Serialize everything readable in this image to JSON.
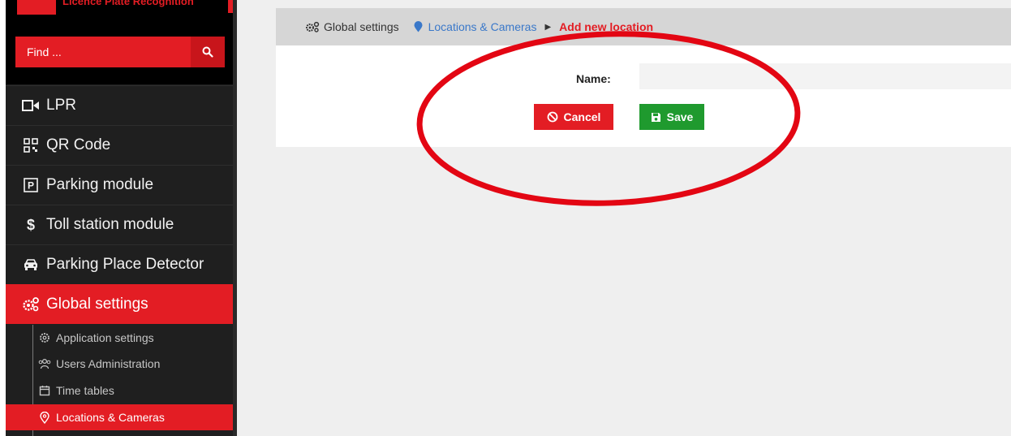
{
  "sidebar": {
    "brand_text": "Licence Plate Recognition",
    "search": {
      "placeholder": "Find ..."
    },
    "nav": [
      {
        "label": "LPR",
        "icon": "video-camera-icon"
      },
      {
        "label": "QR Code",
        "icon": "qr-code-icon"
      },
      {
        "label": "Parking module",
        "icon": "parking-icon"
      },
      {
        "label": "Toll station module",
        "icon": "dollar-icon"
      },
      {
        "label": "Parking Place Detector",
        "icon": "car-icon"
      },
      {
        "label": "Global settings",
        "icon": "gears-icon",
        "active": true
      }
    ],
    "sub_nav": [
      {
        "label": "Application settings",
        "icon": "gear-icon"
      },
      {
        "label": "Users Administration",
        "icon": "users-icon"
      },
      {
        "label": "Time tables",
        "icon": "calendar-icon"
      },
      {
        "label": "Locations & Cameras",
        "icon": "location-pin-icon",
        "active": true
      }
    ]
  },
  "breadcrumb": {
    "global": "Global settings",
    "locations": "Locations & Cameras",
    "current": "Add new location"
  },
  "form": {
    "name_label": "Name:",
    "name_value": "",
    "cancel_label": "Cancel",
    "save_label": "Save"
  },
  "colors": {
    "accent": "#e31d24",
    "sidebar_bg": "#1f1f1f",
    "save_green": "#1f9a2e",
    "link_blue": "#3a78c9",
    "annotation_red": "#e30613"
  }
}
